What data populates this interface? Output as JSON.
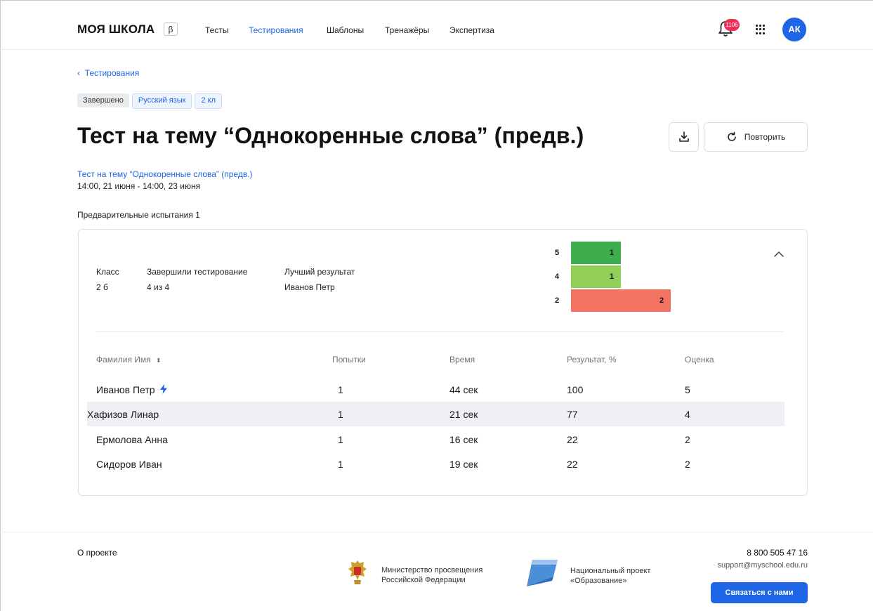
{
  "header": {
    "logo": "МОЯ ШКОЛА",
    "logo_badge": "β",
    "nav": [
      "Тесты",
      "Тестирования",
      "Шаблоны",
      "Тренажёры",
      "Экспертиза"
    ],
    "active_nav": "Тестирования",
    "notifications_count": "1106",
    "avatar_initials": "АК",
    "accent_color": "#1e66e5",
    "badge_color": "#ef2d56"
  },
  "breadcrumb": {
    "back_label": "Тестирования"
  },
  "tags": [
    "Завершено",
    "Русский язык",
    "2 кл"
  ],
  "page": {
    "title": "Тест на тему “Однокоренные слова” (предв.)",
    "repeat_label": "Повторить",
    "subtitle_link": "Тест на тему “Однокоренные слова” (предв.)",
    "date_range": "14:00, 21 июня - 14:00, 23 июня",
    "section_label": "Предварительные испытания 1"
  },
  "summary": {
    "class_label": "Класс",
    "class_value": "2 б",
    "completed_label": "Завершили тестирование",
    "completed_value": "4 из 4",
    "best_label": "Лучший результат",
    "best_value": "Иванов Петр"
  },
  "chart_data": {
    "type": "bar",
    "orientation": "horizontal",
    "categories": [
      "5",
      "4",
      "2"
    ],
    "values": [
      1,
      1,
      2
    ],
    "colors": [
      "#3dae4b",
      "#92cf58",
      "#f47462"
    ]
  },
  "table": {
    "headers": [
      "Фамилия Имя",
      "Попытки",
      "Время",
      "Результат, %",
      "Оценка"
    ],
    "rows": [
      {
        "name": "Иванов Петр",
        "attempts": "1",
        "time": "44 сек",
        "result": "100",
        "grade": "5",
        "flag": "lightning-icon"
      },
      {
        "name": "Хафизов Линар",
        "attempts": "1",
        "time": "21 сек",
        "result": "77",
        "grade": "4"
      },
      {
        "name": "Ермолова Анна",
        "attempts": "1",
        "time": "16 сек",
        "result": "22",
        "grade": "2"
      },
      {
        "name": "Сидоров Иван",
        "attempts": "1",
        "time": "19 сек",
        "result": "22",
        "grade": "2"
      }
    ]
  },
  "footer": {
    "about": "О проекте",
    "ministry_line1": "Министерство просвещения",
    "ministry_line2": "Российской Федерации",
    "project_line1": "Национальный проект",
    "project_line2": "«Образование»",
    "phone": "8 800 505 47 16",
    "email": "support@myschool.edu.ru",
    "contact_button": "Связаться с нами"
  }
}
